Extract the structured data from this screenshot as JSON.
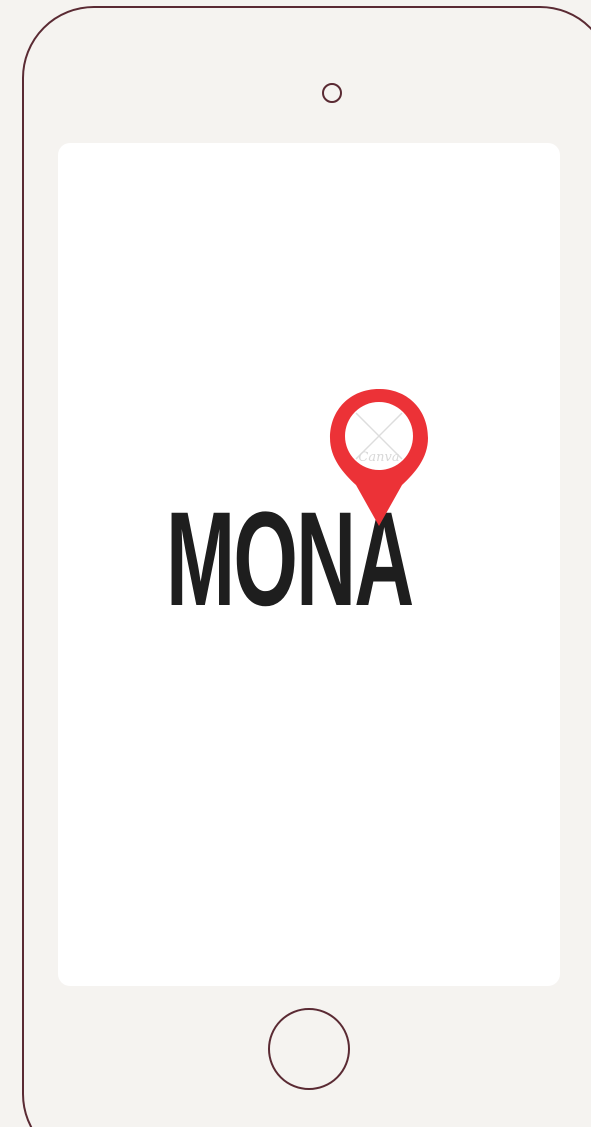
{
  "app": {
    "logo_text": "MONA",
    "pin_watermark": "Canva"
  },
  "device": {
    "camera_icon": "circle-outline",
    "home_button_icon": "circle-outline"
  },
  "colors": {
    "background": "#f5f3f0",
    "device_outline": "#5a2a33",
    "screen": "#ffffff",
    "logo_text": "#1e1e1e",
    "pin": "#ec3237"
  }
}
